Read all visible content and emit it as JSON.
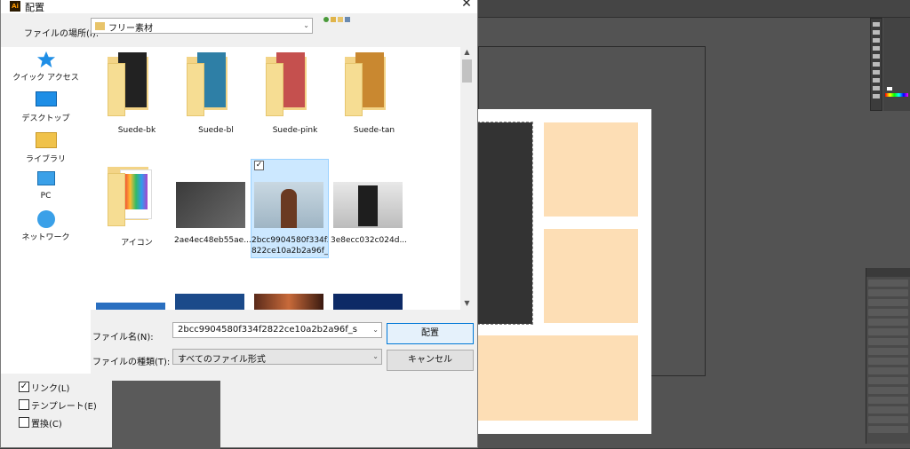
{
  "dialog": {
    "title": "配置",
    "close_glyph": "✕",
    "location_label": "ファイルの場所(I):",
    "location_value": "フリー素材",
    "places": [
      "クイック アクセス",
      "デスクトップ",
      "ライブラリ",
      "PC",
      "ネットワーク"
    ],
    "files": [
      {
        "label": "Suede-bk",
        "kind": "folder",
        "color": "#222222"
      },
      {
        "label": "Suede-bl",
        "kind": "folder",
        "color": "#2e7fa6"
      },
      {
        "label": "Suede-pink",
        "kind": "folder",
        "color": "#c5504e"
      },
      {
        "label": "Suede-tan",
        "kind": "folder",
        "color": "#c98830"
      },
      {
        "label": "アイコン",
        "kind": "folder",
        "color": "#e9b64a"
      },
      {
        "label": "2ae4ec48eb55ae...",
        "kind": "image",
        "color": "#3a3a3a"
      },
      {
        "label_line1": "2bcc9904580f334f2",
        "label_line2": "822ce10a2b2a96f_s",
        "kind": "image",
        "color": "#b6c9d6",
        "selected": true
      },
      {
        "label": "3e8ecc032c024d...",
        "kind": "image",
        "color": "#cfcfcf"
      }
    ],
    "filename_label": "ファイル名(N):",
    "filename_value": "2bcc9904580f334f2822ce10a2b2a96f_s",
    "filetype_label": "ファイルの種類(T):",
    "filetype_value": "すべてのファイル形式",
    "place_button": "配置",
    "cancel_button": "キャンセル",
    "options": [
      {
        "label": "リンク(L)",
        "checked": true
      },
      {
        "label": "テンプレート(E)",
        "checked": false
      },
      {
        "label": "置換(C)",
        "checked": false
      }
    ]
  },
  "icons": {
    "quick_access": "star-icon",
    "desktop": "desktop-icon",
    "library": "library-icon",
    "pc": "computer-icon",
    "network": "network-icon"
  },
  "colors": {
    "accent": "#0078d7",
    "selection": "#cce8ff",
    "peach": "#fddeb5"
  }
}
